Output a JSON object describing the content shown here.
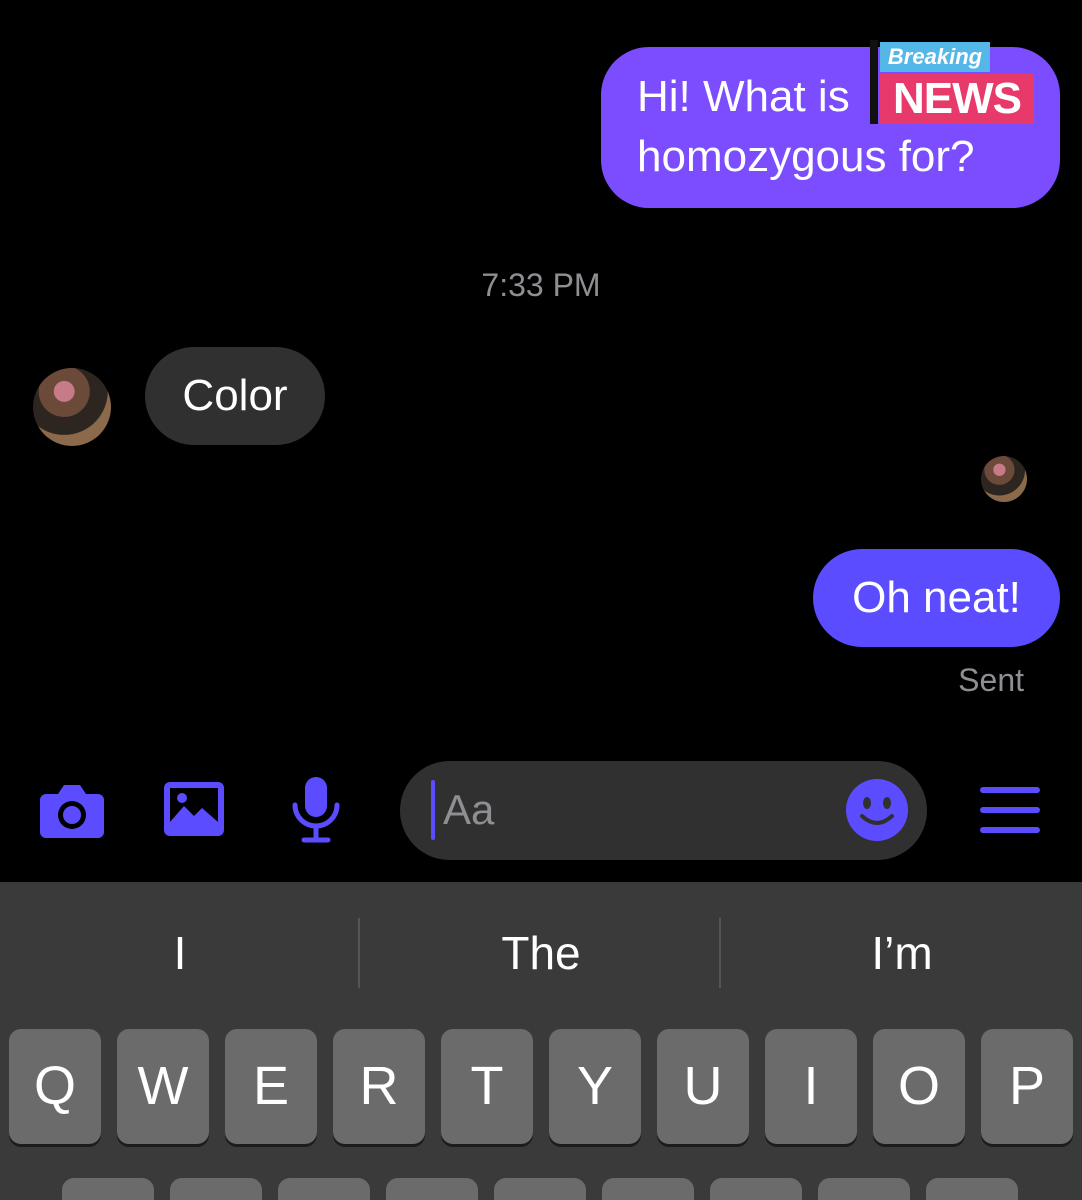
{
  "colors": {
    "background": "#000000",
    "outgoing_bubble": "#7c4dff",
    "outgoing_bubble_2": "#5b4dff",
    "incoming_bubble": "#303030",
    "accent": "#5b4dff",
    "muted_text": "#8e8e93",
    "keyboard_bg": "#3a3a3a",
    "key_bg": "#6b6b6b",
    "sticker_breaking": "#55b7e8",
    "sticker_news": "#e83a6a"
  },
  "messages": {
    "outgoing_1": {
      "line_1": "Hi! What is",
      "line_2": "homozygous for?"
    },
    "sticker": {
      "top": "Breaking",
      "bottom": "NEWS"
    },
    "timestamp": "7:33 PM",
    "incoming_1": "Color",
    "outgoing_2": "Oh neat!",
    "status": "Sent"
  },
  "composer": {
    "icons": [
      "camera-icon",
      "photo-icon",
      "microphone-icon",
      "emoji-icon",
      "menu-icon"
    ],
    "placeholder": "Aa"
  },
  "keyboard": {
    "suggestions": [
      "I",
      "The",
      "I’m"
    ],
    "row_1": [
      "Q",
      "W",
      "E",
      "R",
      "T",
      "Y",
      "U",
      "I",
      "O",
      "P"
    ]
  }
}
